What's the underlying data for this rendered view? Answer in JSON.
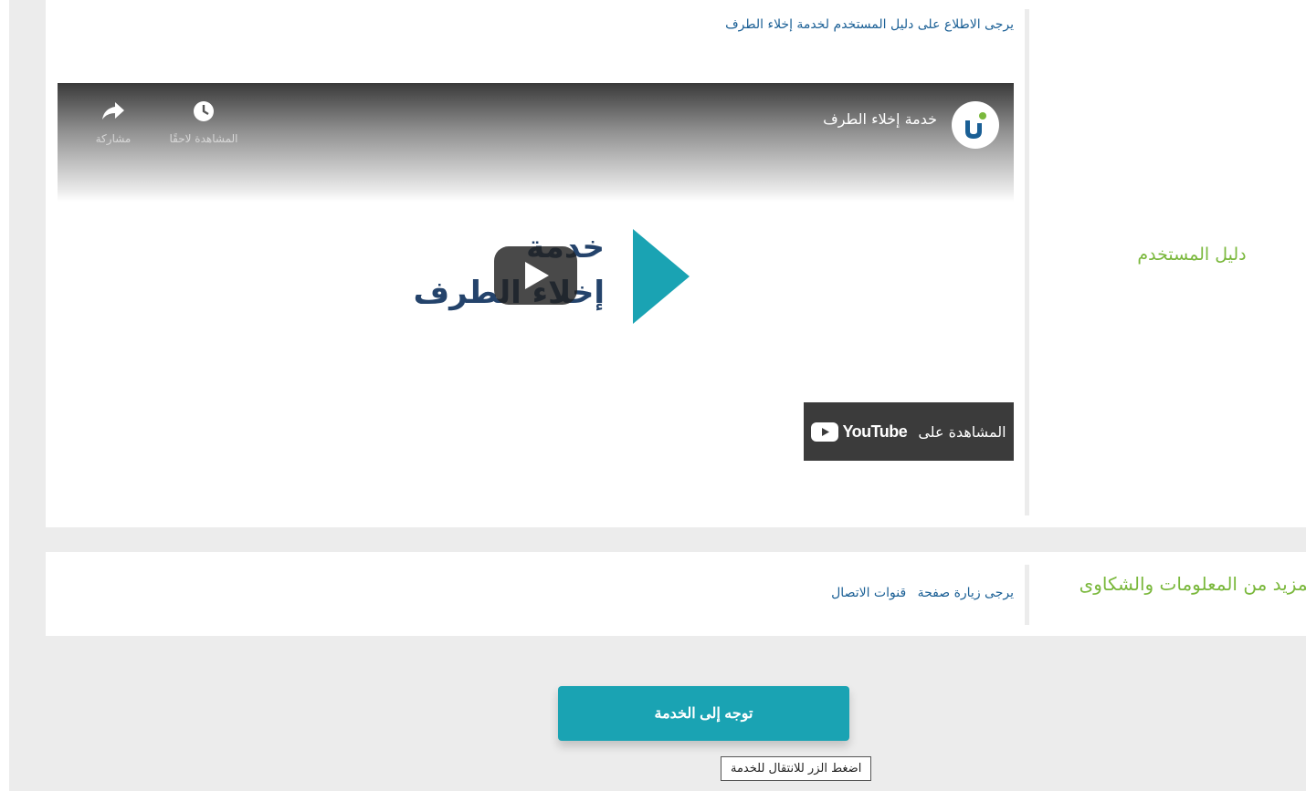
{
  "guide_section": {
    "label": "دليل المستخدم",
    "intro_text": "يرجى الاطلاع على دليل المستخدم لخدمة إخلاء الطرف"
  },
  "video": {
    "title": "خدمة إخلاء الطرف",
    "channel_logo_icon": "channel-logo-icon",
    "watch_later_label": "المشاهدة لاحقًا",
    "share_label": "مشاركة",
    "thumbnail_line1": "خدمة",
    "thumbnail_line2": "إخلاء الطرف",
    "watch_on_label": "المشاهدة على",
    "youtube_wordmark": "YouTube"
  },
  "info_section": {
    "label": "لمزيد من المعلومات والشكاوى",
    "prefix_text": "يرجى زيارة صفحة",
    "link_text": "قنوات الاتصال"
  },
  "actions": {
    "go_button_label": "توجه إلى الخدمة",
    "tooltip_text": "اضغط الزر للانتقال للخدمة"
  },
  "colors": {
    "accent_teal": "#1aa3b3",
    "label_green": "#7ab83c",
    "link_blue": "#1a5f95",
    "thumbnail_navy": "#24436b"
  }
}
